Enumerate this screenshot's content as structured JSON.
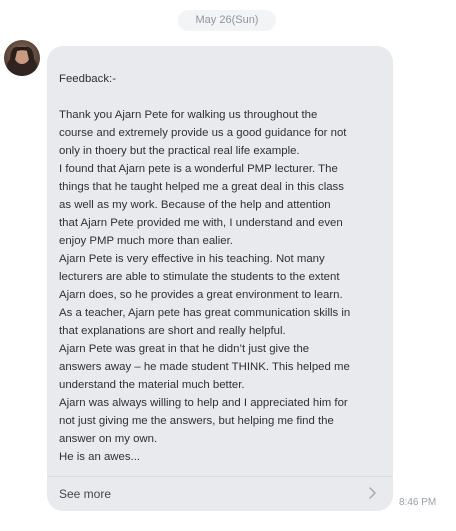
{
  "date_divider": "May 26(Sun)",
  "message": {
    "text": "Feedback:-\n\nThank you Ajarn Pete for walking us throughout the\ncourse and extremely  provide us a good guidance for not\nonly in thoery but the practical real life example.\nI found that Ajarn pete is a wonderful PMP lecturer. The\nthings that he taught helped me a great deal in this class\nas well as my work. Because of the help and attention\nthat Ajarn Pete provided me with, I understand and even\nenjoy PMP much more than ealier.\nAjarn Pete is very effective in his teaching. Not many\nlecturers are able to stimulate the students to the extent\nAjarn does, so he provides a great environment to learn.\nAs a teacher, Ajarn pete has great communication skills in\nthat explanations are short and really helpful.\nAjarn Pete was great in that he didn’t just give the\nanswers away – he made student THINK. This helped me\nunderstand the material much better.\nAjarn was always willing to help and I appreciated him for\nnot just giving me the answers, but helping me find the\nanswer on my own.\nHe is an awes...",
    "see_more_label": "See more",
    "timestamp": "8:46 PM"
  },
  "avatar": {
    "icon": "user-avatar-photo"
  },
  "icons": {
    "see_more": "chevron-right-icon"
  },
  "colors": {
    "bubble": "#e9eaed",
    "text": "#2e3133",
    "muted": "#9ba0a6"
  }
}
